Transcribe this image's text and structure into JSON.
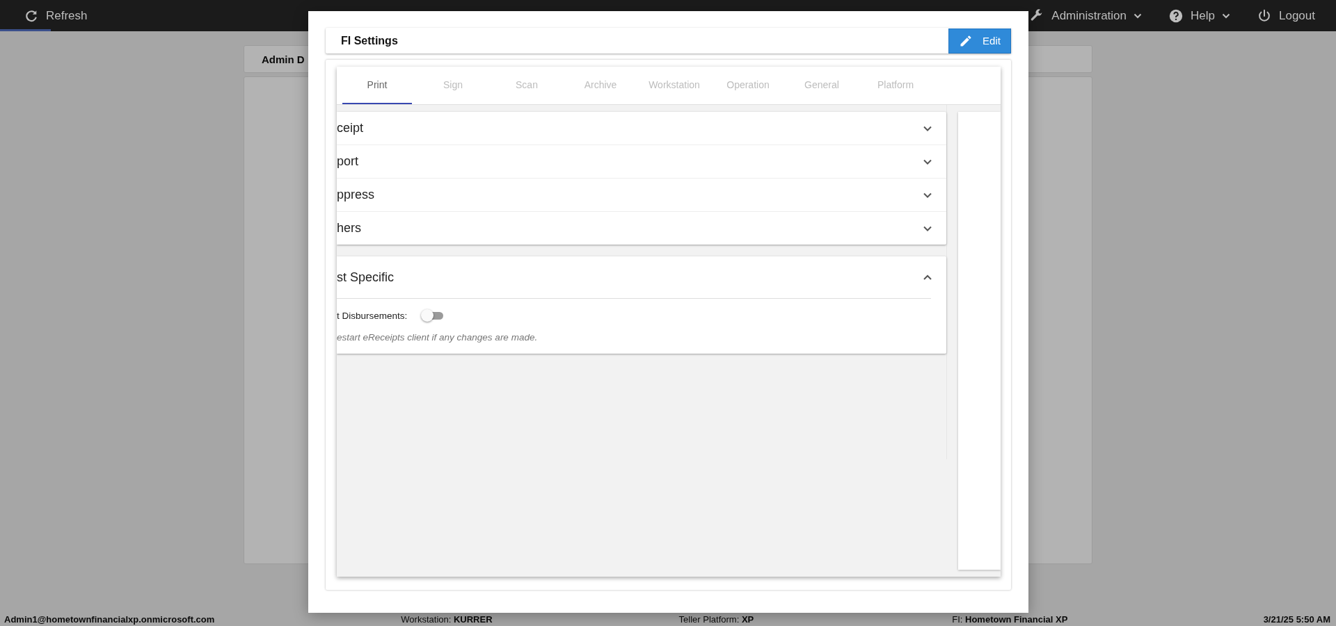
{
  "topbar": {
    "refresh": "Refresh",
    "menus": [
      {
        "label": "Administration",
        "kind": "wrench",
        "dropdown": true
      },
      {
        "label": "Help",
        "kind": "help",
        "dropdown": true
      },
      {
        "label": "Logout",
        "kind": "power",
        "dropdown": false
      }
    ]
  },
  "background_card": {
    "title": "Admin D"
  },
  "dialog": {
    "title": "FI Settings",
    "edit_button": "Edit",
    "tabs": [
      {
        "label": "Print",
        "selected": true
      },
      {
        "label": "Sign",
        "selected": false
      },
      {
        "label": "Scan",
        "selected": false
      },
      {
        "label": "Archive",
        "selected": false
      },
      {
        "label": "Workstation",
        "selected": false
      },
      {
        "label": "Operation",
        "selected": false
      },
      {
        "label": "General",
        "selected": false
      },
      {
        "label": "Platform",
        "selected": false
      }
    ],
    "groups": [
      {
        "items": [
          {
            "title": "ceipt",
            "expanded": false
          },
          {
            "title": "port",
            "expanded": false
          },
          {
            "title": "ppress",
            "expanded": false
          },
          {
            "title": "hers",
            "expanded": false
          }
        ]
      },
      {
        "items": [
          {
            "title": "st Specific",
            "expanded": true,
            "toggle": {
              "label": "t Disbursements:",
              "on": false
            },
            "note": "estart eReceipts client if any changes are made."
          }
        ]
      }
    ]
  },
  "status_bar": {
    "user": "Admin1@hometownfinancialxp.onmicrosoft.com",
    "workstation": "Workstation: **KURRER**",
    "platform": "Teller Platform: **XP**",
    "fi": "FI: **Hometown Financial XP**",
    "datetime": "3/21/25 5:50 AM"
  }
}
